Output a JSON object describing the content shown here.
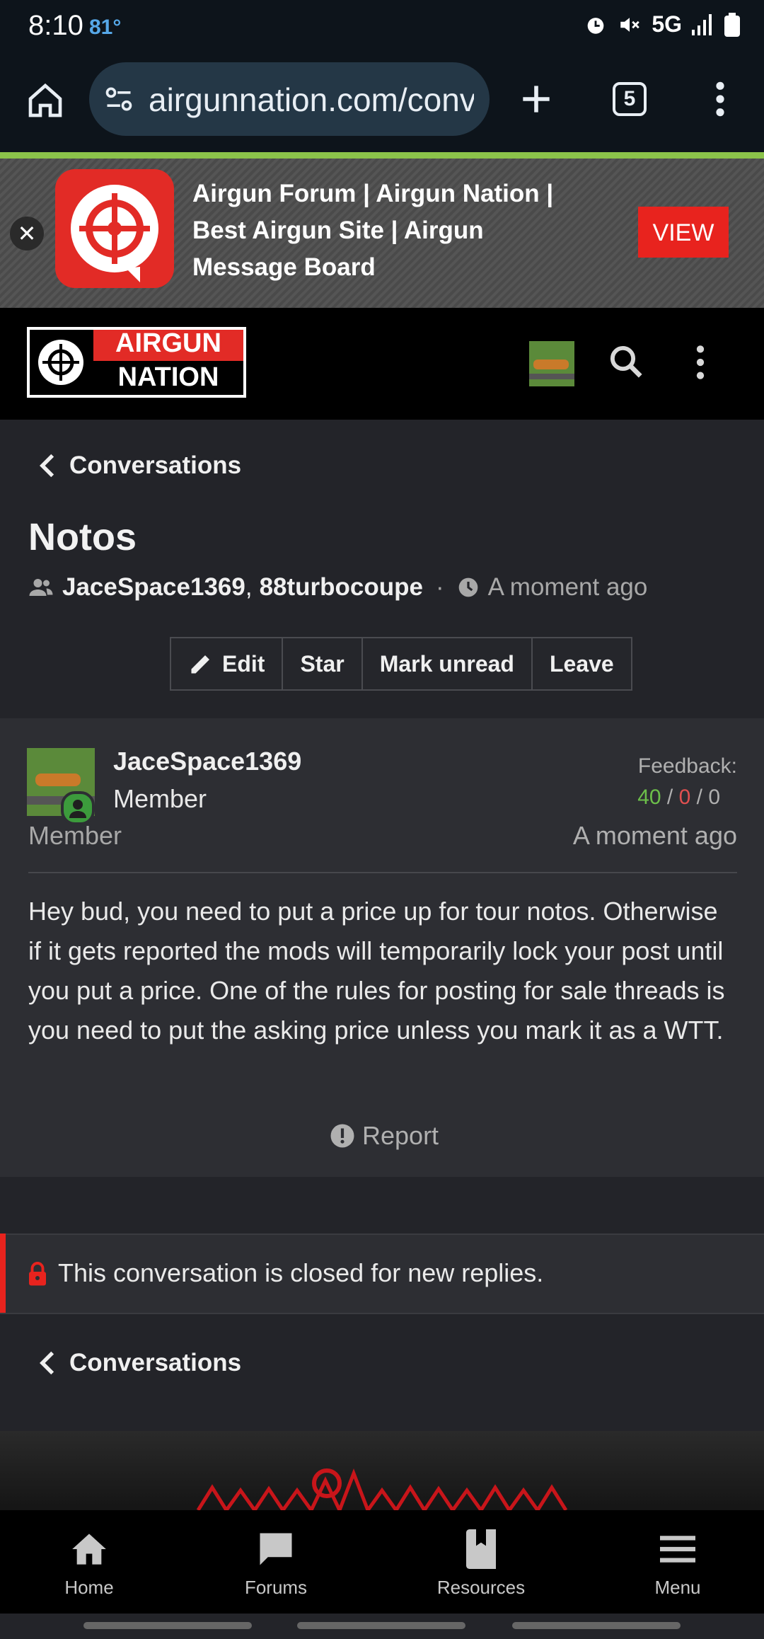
{
  "status_bar": {
    "time": "8:10",
    "temperature": "81°",
    "network": "5G"
  },
  "browser": {
    "url": "airgunnation.com/conv",
    "tab_count": "5"
  },
  "app_banner": {
    "title": "Airgun Forum | Airgun Nation | Best Airgun Site | Airgun Message Board",
    "view_label": "VIEW"
  },
  "site": {
    "logo_line1": "AIRGUN",
    "logo_line2": "NATION"
  },
  "breadcrumb": {
    "label": "Conversations"
  },
  "conversation": {
    "title": "Notos",
    "participant1": "JaceSpace1369",
    "participant2": "88turbocoupe",
    "separator": ",",
    "dot": "·",
    "time": "A moment ago"
  },
  "actions": {
    "edit": "Edit",
    "star": "Star",
    "mark_unread": "Mark unread",
    "leave": "Leave"
  },
  "message": {
    "author": "JaceSpace1369",
    "role": "Member",
    "role2": "Member",
    "feedback_label": "Feedback:",
    "feedback_positive": "40",
    "feedback_neutral": "0",
    "feedback_negative": "0",
    "slash": "/",
    "time": "A moment ago",
    "body": "Hey bud, you need to put a price up for tour notos. Otherwise if it gets reported the mods will temporarily lock your post until you put a price. One of the rules for posting for sale threads is you need to put the asking price unless you mark it as a WTT.",
    "report_label": "Report"
  },
  "notice": {
    "closed": "This conversation is closed for new replies."
  },
  "breadcrumb_bottom": {
    "label": "Conversations"
  },
  "bottom_nav": {
    "home": "Home",
    "forums": "Forums",
    "resources": "Resources",
    "menu": "Menu"
  },
  "colors": {
    "accent_red": "#e8231e",
    "positive_green": "#6cbf4a",
    "neutral_red": "#e05050"
  }
}
